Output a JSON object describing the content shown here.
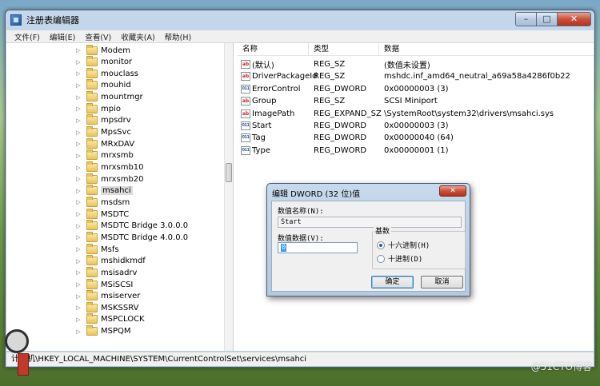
{
  "window": {
    "title": "注册表编辑器",
    "menu": [
      "文件(F)",
      "编辑(E)",
      "查看(V)",
      "收藏夹(A)",
      "帮助(H)"
    ],
    "buttons": {
      "minimize": "–",
      "maximize": "□",
      "close": "✕"
    }
  },
  "tree": {
    "items": [
      {
        "label": "Modem",
        "expander": "▷"
      },
      {
        "label": "monitor",
        "expander": "▷"
      },
      {
        "label": "mouclass",
        "expander": "▷"
      },
      {
        "label": "mouhid",
        "expander": "▷"
      },
      {
        "label": "mountmgr",
        "expander": "▷"
      },
      {
        "label": "mpio",
        "expander": "▷"
      },
      {
        "label": "mpsdrv",
        "expander": "▷"
      },
      {
        "label": "MpsSvc",
        "expander": "▷"
      },
      {
        "label": "MRxDAV",
        "expander": "▷"
      },
      {
        "label": "mrxsmb",
        "expander": "▷"
      },
      {
        "label": "mrxsmb10",
        "expander": "▷"
      },
      {
        "label": "mrxsmb20",
        "expander": "▷"
      },
      {
        "label": "msahci",
        "expander": "▷",
        "selected": true
      },
      {
        "label": "msdsm",
        "expander": "▷"
      },
      {
        "label": "MSDTC",
        "expander": "▷"
      },
      {
        "label": "MSDTC Bridge 3.0.0.0",
        "expander": "▷"
      },
      {
        "label": "MSDTC Bridge 4.0.0.0",
        "expander": "▷"
      },
      {
        "label": "Msfs",
        "expander": "▷"
      },
      {
        "label": "mshidkmdf",
        "expander": "▷"
      },
      {
        "label": "msisadrv",
        "expander": "▷"
      },
      {
        "label": "MSiSCSI",
        "expander": "▷"
      },
      {
        "label": "msiserver",
        "expander": "▷"
      },
      {
        "label": "MSKSSRV",
        "expander": "▷"
      },
      {
        "label": "MSPCLOCK",
        "expander": "▷"
      },
      {
        "label": "MSPQM",
        "expander": "▷"
      }
    ]
  },
  "values": {
    "headers": [
      "名称",
      "类型",
      "数据"
    ],
    "rows": [
      {
        "name": "(默认)",
        "type": "REG_SZ",
        "data": "(数值未设置)",
        "icon": "ab"
      },
      {
        "name": "DriverPackageId",
        "type": "REG_SZ",
        "data": "mshdc.inf_amd64_neutral_a69a58a4286f0b22",
        "icon": "ab"
      },
      {
        "name": "ErrorControl",
        "type": "REG_DWORD",
        "data": "0x00000003 (3)",
        "icon": "011"
      },
      {
        "name": "Group",
        "type": "REG_SZ",
        "data": "SCSI Miniport",
        "icon": "ab"
      },
      {
        "name": "ImagePath",
        "type": "REG_EXPAND_SZ",
        "data": "\\SystemRoot\\system32\\drivers\\msahci.sys",
        "icon": "ab"
      },
      {
        "name": "Start",
        "type": "REG_DWORD",
        "data": "0x00000003 (3)",
        "icon": "011"
      },
      {
        "name": "Tag",
        "type": "REG_DWORD",
        "data": "0x00000040 (64)",
        "icon": "011"
      },
      {
        "name": "Type",
        "type": "REG_DWORD",
        "data": "0x00000001 (1)",
        "icon": "011"
      }
    ]
  },
  "statusbar": {
    "path": "计算机\\HKEY_LOCAL_MACHINE\\SYSTEM\\CurrentControlSet\\services\\msahci"
  },
  "dialog": {
    "title": "编辑 DWORD (32 位)值",
    "close": "✕",
    "name_label": "数值名称(N):",
    "name_value": "Start",
    "data_label": "数值数据(V):",
    "data_value": "0",
    "base_label": "基数",
    "radio_hex": "十六进制(H)",
    "radio_dec": "十进制(D)",
    "selected_base": "hex",
    "ok": "确定",
    "cancel": "取消"
  },
  "watermark": "@51CTO博客"
}
